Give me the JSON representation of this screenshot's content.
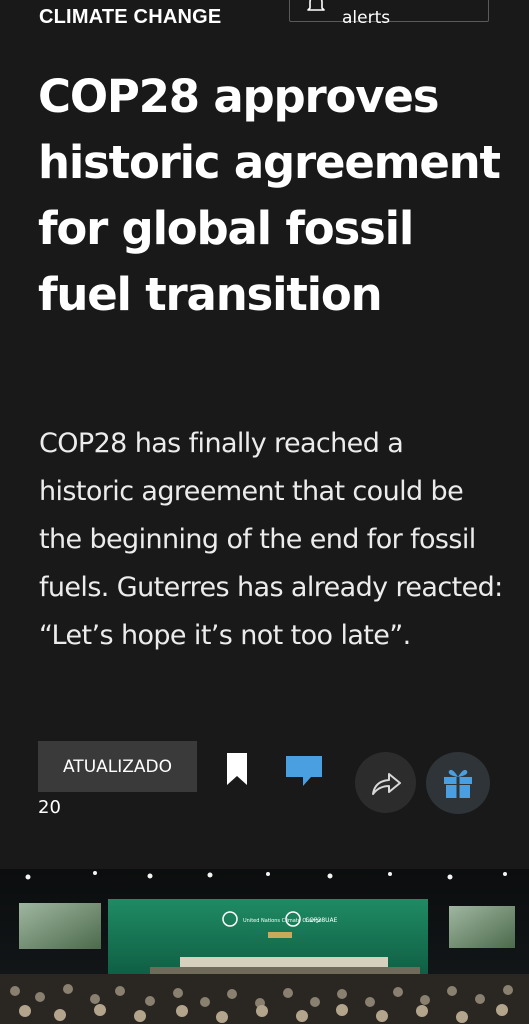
{
  "section": {
    "label": "CLIMATE CHANGE"
  },
  "alerts": {
    "label": "alerts",
    "icon": "bell-icon"
  },
  "article": {
    "headline": "COP28 approves historic agreement for global fossil fuel transition",
    "summary": "COP28 has finally reached a historic agreement that could be the beginning of the end for fossil fuels. Guterres has already reacted: “Let’s hope it’s not too late”."
  },
  "meta": {
    "updated_label": "ATUALIZADO",
    "updated_value": "20"
  },
  "actions": {
    "bookmark_icon": "bookmark-icon",
    "comment_icon": "comment-icon",
    "share_icon": "share-icon",
    "gift_icon": "gift-icon",
    "comment_color": "#4a9fe0",
    "gift_color": "#4a9fe0"
  },
  "hero": {
    "stage_banner_left": "United Nations Climate Change",
    "stage_banner_right": "COP28UAE"
  }
}
